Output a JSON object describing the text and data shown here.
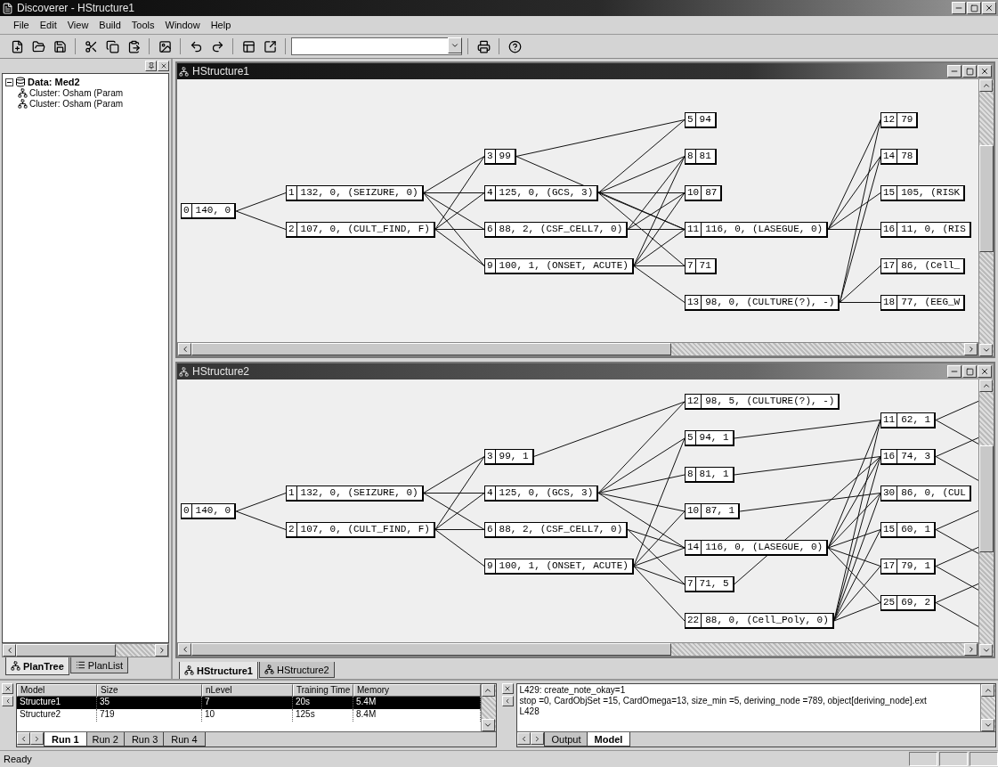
{
  "window": {
    "title": "Discoverer - HStructure1"
  },
  "menu": [
    "File",
    "Edit",
    "View",
    "Build",
    "Tools",
    "Window",
    "Help"
  ],
  "left_panel": {
    "tree": [
      {
        "label": "Data: Med2",
        "expanded": true,
        "children": [
          {
            "label": "Cluster: Osham (Param"
          },
          {
            "label": "Cluster: Osham (Param"
          }
        ]
      }
    ],
    "tabs": [
      {
        "label": "PlanTree",
        "selected": true
      },
      {
        "label": "PlanList",
        "selected": false
      }
    ]
  },
  "documents": [
    {
      "title": "HStructure1",
      "columns": [
        [
          {
            "number": "0",
            "text": "140, 0"
          }
        ],
        [
          {
            "number": "1",
            "text": "132, 0, (SEIZURE, 0)"
          },
          {
            "number": "2",
            "text": "107, 0, (CULT_FIND, F)"
          }
        ],
        [
          {
            "number": "3",
            "text": "99"
          },
          {
            "number": "4",
            "text": "125, 0, (GCS, 3)"
          },
          {
            "number": "6",
            "text": "88, 2, (CSF_CELL7, 0)"
          },
          {
            "number": "9",
            "text": "100, 1, (ONSET, ACUTE)"
          }
        ],
        [
          {
            "number": "5",
            "text": "94"
          },
          {
            "number": "8",
            "text": "81"
          },
          {
            "number": "10",
            "text": "87"
          },
          {
            "number": "11",
            "text": "116, 0, (LASEGUE, 0)"
          },
          {
            "number": "7",
            "text": "71"
          },
          {
            "number": "13",
            "text": "98, 0, (CULTURE(?), -)"
          }
        ],
        [
          {
            "number": "12",
            "text": "79"
          },
          {
            "number": "14",
            "text": "78"
          },
          {
            "number": "15",
            "text": "105, (RISK"
          },
          {
            "number": "16",
            "text": "11, 0, (RIS"
          },
          {
            "number": "17",
            "text": "86, (Cell_"
          },
          {
            "number": "18",
            "text": "77, (EEG_W"
          }
        ]
      ]
    },
    {
      "title": "HStructure2",
      "columns": [
        [
          {
            "number": "0",
            "text": "140, 0"
          }
        ],
        [
          {
            "number": "1",
            "text": "132, 0, (SEIZURE, 0)"
          },
          {
            "number": "2",
            "text": "107, 0, (CULT_FIND, F)"
          }
        ],
        [
          {
            "number": "3",
            "text": "99, 1"
          },
          {
            "number": "4",
            "text": "125, 0, (GCS, 3)"
          },
          {
            "number": "6",
            "text": "88, 2, (CSF_CELL7, 0)"
          },
          {
            "number": "9",
            "text": "100, 1, (ONSET, ACUTE)"
          }
        ],
        [
          {
            "number": "12",
            "text": "98, 5, (CULTURE(?), -)"
          },
          {
            "number": "5",
            "text": "94, 1"
          },
          {
            "number": "8",
            "text": "81, 1"
          },
          {
            "number": "10",
            "text": "87, 1"
          },
          {
            "number": "14",
            "text": "116, 0, (LASEGUE, 0)"
          },
          {
            "number": "7",
            "text": "71, 5"
          },
          {
            "number": "22",
            "text": "88, 0, (Cell_Poly, 0)"
          }
        ],
        [
          {
            "number": "11",
            "text": "62, 1"
          },
          {
            "number": "16",
            "text": "74, 3"
          },
          {
            "number": "30",
            "text": "86, 0, (CUL"
          },
          {
            "number": "15",
            "text": "60, 1"
          },
          {
            "number": "17",
            "text": "79, 1"
          },
          {
            "number": "25",
            "text": "69, 2"
          }
        ]
      ]
    }
  ],
  "document_tabs": [
    {
      "label": "HStructure1",
      "selected": true
    },
    {
      "label": "HStructure2",
      "selected": false
    }
  ],
  "results_table": {
    "columns": [
      "Model",
      "Size",
      "nLevel",
      "Training Time",
      "Memory"
    ],
    "rows": [
      {
        "cells": [
          "Structure1",
          "35",
          "7",
          "20s",
          "5.4M"
        ],
        "selected": true
      },
      {
        "cells": [
          "Structure2",
          "719",
          "10",
          "125s",
          "8.4M"
        ],
        "selected": false
      }
    ],
    "sheet_tabs": [
      {
        "label": "Run 1",
        "selected": true
      },
      {
        "label": "Run 2",
        "selected": false
      },
      {
        "label": "Run 3",
        "selected": false
      },
      {
        "label": "Run 4",
        "selected": false
      }
    ]
  },
  "log": {
    "lines": [
      "L429: create_note_okay=1",
      "stop =0, CardObjSet =15, CardOmega=13, size_min =5, deriving_node =789, object[deriving_node].ext",
      "L428"
    ],
    "tabs": [
      {
        "label": "Output",
        "selected": false
      },
      {
        "label": "Model",
        "selected": true
      }
    ]
  },
  "status_bar": {
    "text": "Ready"
  }
}
